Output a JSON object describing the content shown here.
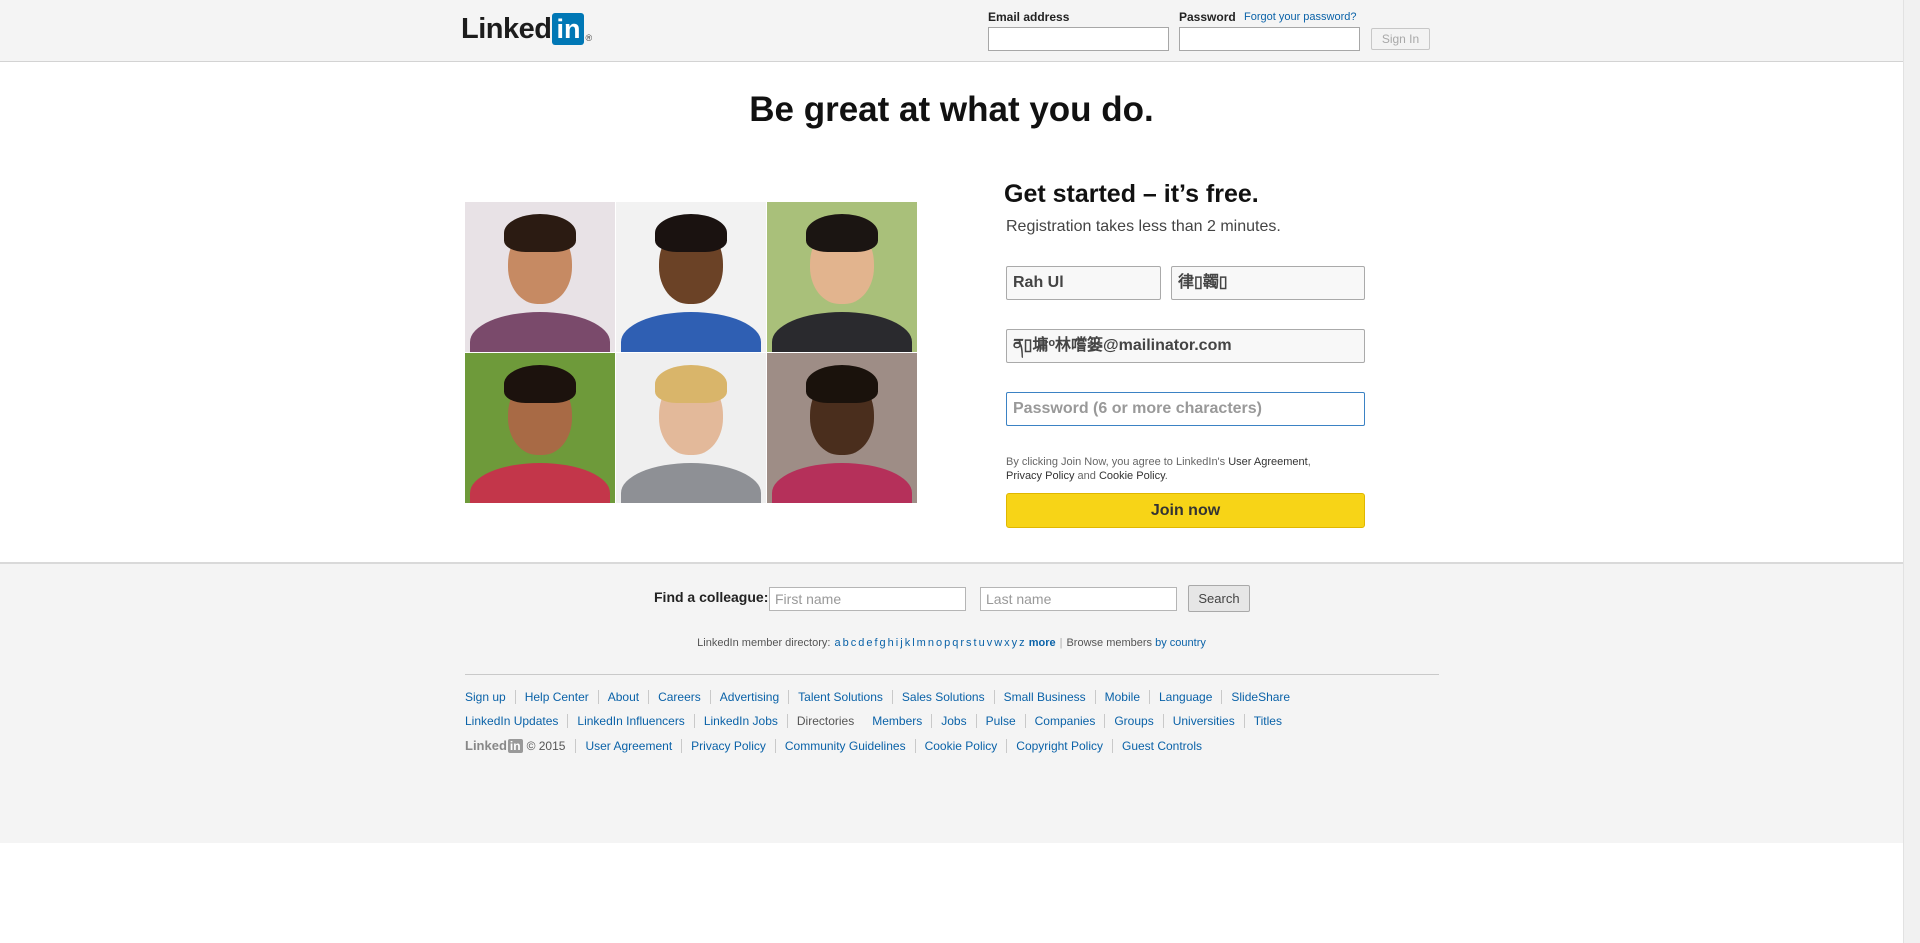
{
  "header": {
    "logo_text": "Linked",
    "logo_box": "in",
    "logo_reg": "®",
    "email_label": "Email address",
    "password_label": "Password",
    "forgot_link": "Forgot your password?",
    "signin_label": "Sign In"
  },
  "hero": {
    "tagline": "Be great at what you do.",
    "signup_title": "Get started – it’s free.",
    "signup_subtitle": "Registration takes less than 2 minutes.",
    "first_name_value": "Rah Ul",
    "last_name_value": "律▯韣▯",
    "email_value": "ན▯墉ᵒ林嚐篓@mailinator.com",
    "password_placeholder": "Password (6 or more characters)",
    "terms_prefix": "By clicking Join Now, you agree to LinkedIn's ",
    "terms_user_agreement": "User Agreement",
    "terms_comma": ",",
    "terms_privacy": "Privacy Policy",
    "terms_and": " and ",
    "terms_cookie": "Cookie Policy",
    "terms_period": ".",
    "join_label": "Join now"
  },
  "photos": [
    {
      "bg": "#e8e2e6",
      "skin": "#c68a63",
      "hair": "#2b1b12",
      "shirt": "#7a4a6b"
    },
    {
      "bg": "#f2f2f2",
      "skin": "#6b4226",
      "hair": "#1a1210",
      "shirt": "#2f5fb3"
    },
    {
      "bg": "#a9c07a",
      "skin": "#e2b48e",
      "hair": "#1b1512",
      "shirt": "#2a2a2e"
    },
    {
      "bg": "#6e9a3a",
      "skin": "#a86a45",
      "hair": "#1c120d",
      "shirt": "#c3364a"
    },
    {
      "bg": "#efefef",
      "skin": "#e3b99a",
      "hair": "#d9b56a",
      "shirt": "#8e9095"
    },
    {
      "bg": "#9e8d86",
      "skin": "#4a2e1d",
      "hair": "#1a120c",
      "shirt": "#b5305a"
    }
  ],
  "footer": {
    "find_label": "Find a colleague:",
    "first_placeholder": "First name",
    "last_placeholder": "Last name",
    "search_label": "Search",
    "directory_prefix": "LinkedIn member directory: ",
    "letters": [
      "a",
      "b",
      "c",
      "d",
      "e",
      "f",
      "g",
      "h",
      "i",
      "j",
      "k",
      "l",
      "m",
      "n",
      "o",
      "p",
      "q",
      "r",
      "s",
      "t",
      "u",
      "v",
      "w",
      "x",
      "y",
      "z"
    ],
    "more": "more",
    "browse_prefix": "Browse members ",
    "browse_link": "by country",
    "row1": [
      "Sign up",
      "Help Center",
      "About",
      "Careers",
      "Advertising",
      "Talent Solutions",
      "Sales Solutions",
      "Small Business",
      "Mobile",
      "Language",
      "SlideShare"
    ],
    "row2": [
      "LinkedIn Updates",
      "LinkedIn Influencers",
      "LinkedIn Jobs",
      "Directories",
      "Members",
      "Jobs",
      "Pulse",
      "Companies",
      "Groups",
      "Universities",
      "Titles"
    ],
    "mini_logo_text": "Linked",
    "mini_logo_box": "in",
    "copyright": "© 2015",
    "row3": [
      "User Agreement",
      "Privacy Policy",
      "Community Guidelines",
      "Cookie Policy",
      "Copyright Policy",
      "Guest Controls"
    ]
  },
  "colors": {
    "brand_blue": "#0077b5",
    "join_yellow": "#f7d417",
    "link_blue": "#0a62a8"
  }
}
